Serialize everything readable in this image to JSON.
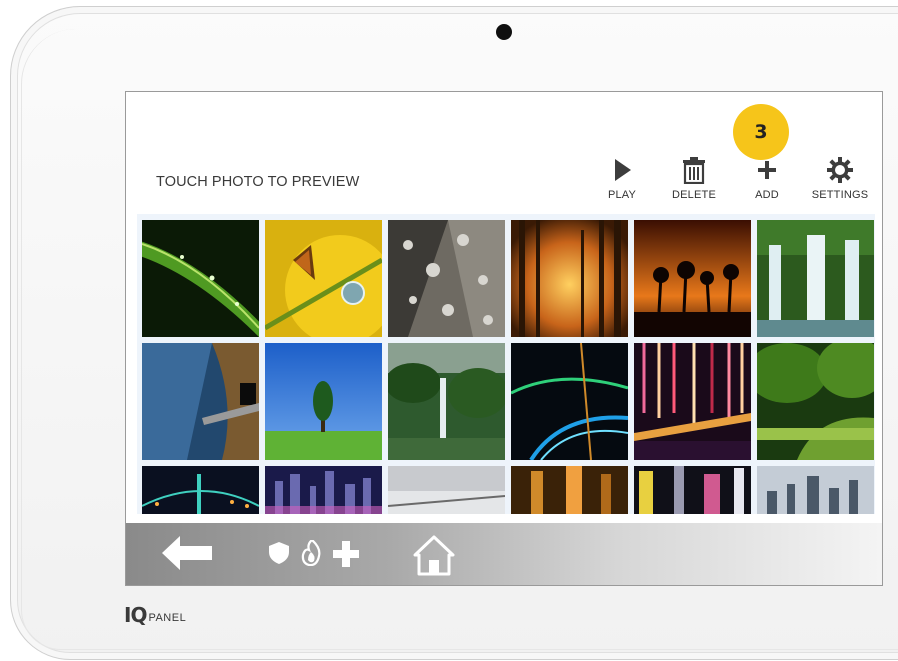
{
  "screen": {
    "title": "TOUCH PHOTO TO PREVIEW",
    "toolbar": {
      "play_label": "PLAY",
      "delete_label": "DELETE",
      "add_label": "ADD",
      "settings_label": "SETTINGS"
    },
    "step_badge": "3"
  },
  "photos": [
    {
      "row": 1,
      "subject": "green leaf with water drops"
    },
    {
      "row": 1,
      "subject": "butterfly on yellow flower with dew"
    },
    {
      "row": 1,
      "subject": "water drops on grey leaf"
    },
    {
      "row": 1,
      "subject": "misty golden forest"
    },
    {
      "row": 1,
      "subject": "palm trees at sunset"
    },
    {
      "row": 1,
      "subject": "waterfalls"
    },
    {
      "row": 2,
      "subject": "blue rock canyon tunnel"
    },
    {
      "row": 2,
      "subject": "lone tree in green field"
    },
    {
      "row": 2,
      "subject": "tropical jungle waterfall"
    },
    {
      "row": 2,
      "subject": "light trails at night"
    },
    {
      "row": 2,
      "subject": "lit bridge at night"
    },
    {
      "row": 2,
      "subject": "forest canopy over river"
    },
    {
      "row": 3,
      "subject": "bridge at night"
    },
    {
      "row": 3,
      "subject": "city skyline at night"
    },
    {
      "row": 3,
      "subject": "cloudy sky bridge"
    },
    {
      "row": 3,
      "subject": "towers at dusk"
    },
    {
      "row": 3,
      "subject": "city street at night"
    },
    {
      "row": 3,
      "subject": "city skyline daytime"
    }
  ],
  "navbar": {
    "icons": [
      "back-arrow-icon",
      "shield-icon",
      "fire-icon",
      "medical-cross-icon",
      "home-icon"
    ]
  },
  "brand": {
    "logo_iq": "IQ",
    "logo_panel": "PANEL"
  },
  "colors": {
    "badge": "#f6c51a",
    "navbar_dark": "#8a8a8a",
    "navbar_light": "#f4f4f4"
  }
}
